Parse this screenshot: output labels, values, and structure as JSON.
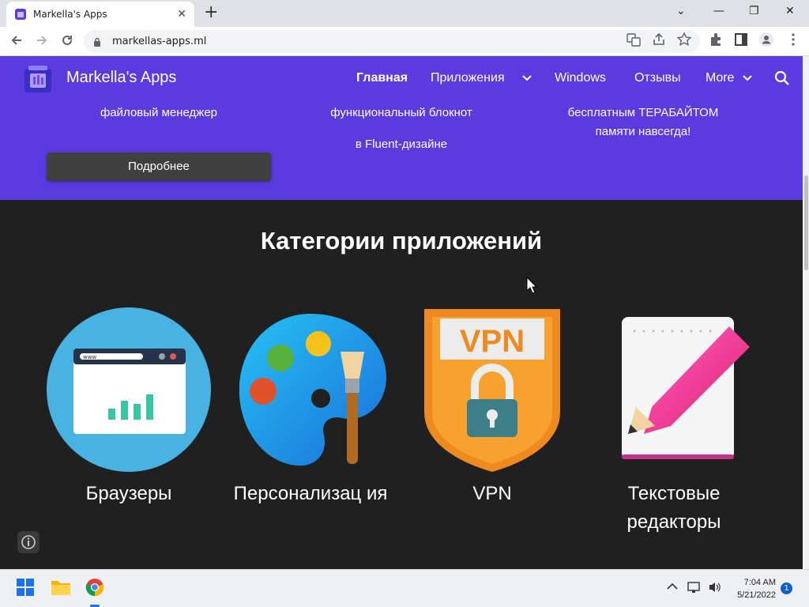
{
  "browser": {
    "tab_title": "Markella's Apps",
    "url": "markellas-apps.ml",
    "new_tab_symbol": "+",
    "close_symbol": "✕",
    "min_symbol": "—",
    "restore_symbol": "❐",
    "chevron_symbol": "⌄"
  },
  "site": {
    "brand": "Markella's Apps",
    "nav": {
      "home": "Главная",
      "apps": "Приложения",
      "windows": "Windows",
      "reviews": "Отзывы",
      "more": "More"
    },
    "hero": {
      "col1_line": "файловый менеджер",
      "col2_line1": "функциональный блокнот",
      "col2_line2": "в Fluent-дизайне",
      "col3_line1": "бесплатным ТЕРАБАЙТОМ",
      "col3_line2": "памяти навсегда!",
      "more_button": "Подробнее"
    },
    "categories": {
      "title": "Категории приложений",
      "items": [
        {
          "label": "Браузеры"
        },
        {
          "label": "Персонализац ия"
        },
        {
          "label": "VPN"
        },
        {
          "label": "Текстовые редакторы"
        }
      ],
      "vpn_badge": "VPN",
      "browser_url_text": "www"
    }
  },
  "taskbar": {
    "time": "7:04 AM",
    "date": "5/21/2022",
    "notifications": "1"
  },
  "colors": {
    "brand_purple": "#5b3ae0",
    "dark_bg": "#202020",
    "button_dark": "#404040"
  }
}
